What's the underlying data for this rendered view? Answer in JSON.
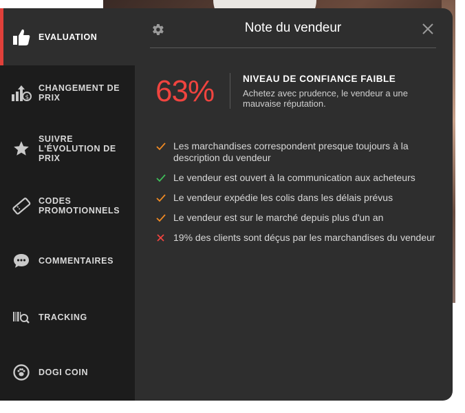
{
  "sidebar": {
    "items": [
      {
        "label": "EVALUATION",
        "icon": "thumbs-up-icon",
        "active": true
      },
      {
        "label": "CHANGEMENT DE PRIX",
        "icon": "price-chart-icon"
      },
      {
        "label": "SUIVRE L'ÉVOLUTION DE PRIX",
        "icon": "star-icon"
      },
      {
        "label": "CODES PROMOTIONNELS",
        "icon": "coupon-icon"
      },
      {
        "label": "COMMENTAIRES",
        "icon": "comment-icon"
      },
      {
        "label": "TRACKING",
        "icon": "barcode-search-icon"
      },
      {
        "label": "DOGI COIN",
        "icon": "paw-coin-icon"
      }
    ]
  },
  "header": {
    "title": "Note du vendeur"
  },
  "rating": {
    "score": "63%",
    "level": "NIVEAU DE CONFIANCE FAIBLE",
    "description": "Achetez avec prudence, le vendeur a une mauvaise réputation."
  },
  "criteria": [
    {
      "text": "Les marchandises correspondent presque toujours à la description du vendeur",
      "status": "partial",
      "color": "#f08a24"
    },
    {
      "text": "Le vendeur est ouvert à la communication aux acheteurs",
      "status": "good",
      "color": "#3fbf5a"
    },
    {
      "text": "Le vendeur expédie les colis dans les délais prévus",
      "status": "partial",
      "color": "#f08a24"
    },
    {
      "text": "Le vendeur est sur le marché depuis plus d'un an",
      "status": "partial",
      "color": "#f08a24"
    },
    {
      "text": "19% des clients sont déçus par les marchandises du vendeur",
      "status": "bad",
      "color": "#f0443f"
    }
  ],
  "colors": {
    "accent": "#e0403a",
    "score": "#f0443f",
    "panel": "#2e2e2e",
    "sidebar": "#1c1c1c"
  }
}
